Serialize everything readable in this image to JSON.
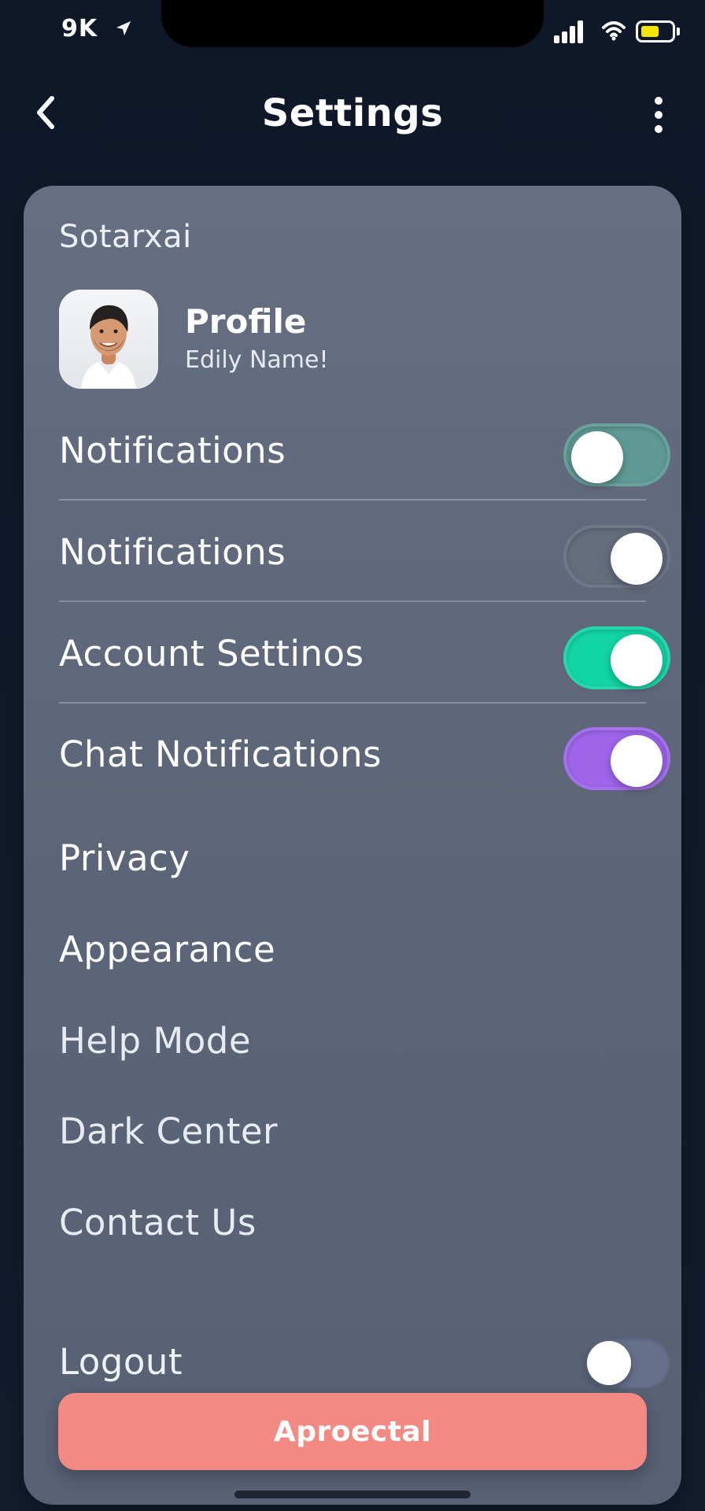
{
  "status_bar": {
    "time": "9K",
    "battery_level": 0.35,
    "colors": {
      "battery_fill": "#f2e600"
    },
    "icons": {
      "location": "location-arrow-icon",
      "signal": "cellular-signal-icon",
      "wifi": "wifi-icon",
      "battery": "battery-icon"
    }
  },
  "header": {
    "title": "Settings",
    "icons": {
      "back": "chevron-left-icon",
      "more": "more-vertical-icon"
    }
  },
  "settings": {
    "section_label": "Sotarxai",
    "profile": {
      "title": "Profile",
      "subtitle": "Edily Name!",
      "avatar": "profile-photo"
    },
    "toggle_rows": [
      {
        "label": "Notifications",
        "enabled": false,
        "track_color": "#5f9994"
      },
      {
        "label": "Notifications",
        "enabled": true,
        "track_color": "#646c7e"
      },
      {
        "label": "Account Settinos",
        "enabled": true,
        "track_color": "#13d4a5"
      },
      {
        "label": "Chat Notifications",
        "enabled": true,
        "track_color": "#9e64ea"
      }
    ],
    "menu_items": [
      "Privacy",
      "Appearance",
      "Help Mode",
      "Dark Center",
      "Contact Us"
    ],
    "logout": {
      "label": "Logout",
      "enabled": false,
      "track_color": "#67708a"
    },
    "primary_button": {
      "label": "Aproectal",
      "background": "#f08a83"
    }
  }
}
